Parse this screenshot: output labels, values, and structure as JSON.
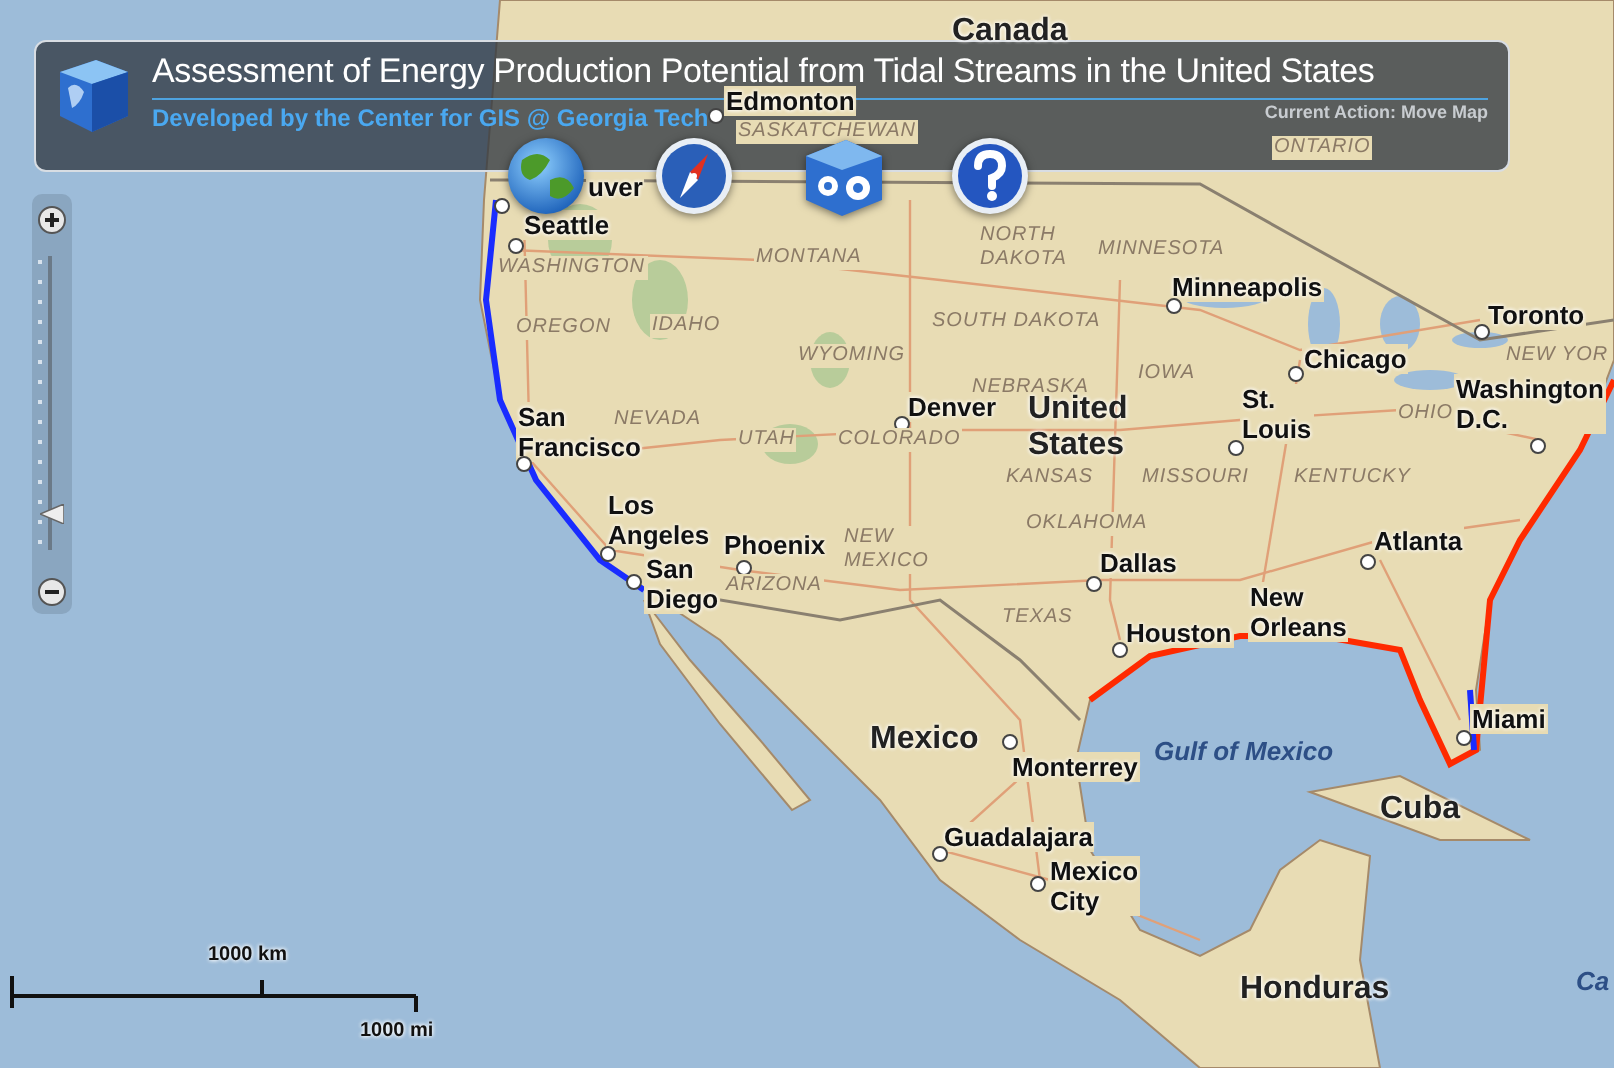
{
  "header": {
    "title": "Assessment of Energy Production Potential from Tidal Streams in the United States",
    "subtitle": "Developed by the Center for GIS @ Georgia Tech",
    "current_action": "Current Action: Move Map"
  },
  "toolbar": [
    {
      "kind": "globe"
    },
    {
      "kind": "compass"
    },
    {
      "kind": "settings"
    },
    {
      "kind": "help"
    }
  ],
  "zoom_control": {
    "level": 0.12
  },
  "scale_bar": {
    "km_label": "1000 km",
    "mi_label": "1000 mi"
  },
  "map": {
    "labels": [
      {
        "text": "Canada",
        "kind": "country"
      },
      {
        "text": "Edmonton",
        "kind": "city"
      },
      {
        "text": "SASKATCHEWAN",
        "kind": "state"
      },
      {
        "text": "ONTARIO",
        "kind": "state"
      },
      {
        "text": "uver",
        "kind": "city"
      },
      {
        "text": "Seattle",
        "kind": "city"
      },
      {
        "text": "WASHINGTON",
        "kind": "state"
      },
      {
        "text": "MONTANA",
        "kind": "state"
      },
      {
        "text": "NORTH DAKOTA",
        "kind": "state"
      },
      {
        "text": "MINNESOTA",
        "kind": "state"
      },
      {
        "text": "Minneapolis",
        "kind": "city"
      },
      {
        "text": "OREGON",
        "kind": "state"
      },
      {
        "text": "IDAHO",
        "kind": "state"
      },
      {
        "text": "SOUTH DAKOTA",
        "kind": "state"
      },
      {
        "text": "Toronto",
        "kind": "city"
      },
      {
        "text": "WYOMING",
        "kind": "state"
      },
      {
        "text": "Chicago",
        "kind": "city"
      },
      {
        "text": "NEW YOR",
        "kind": "state"
      },
      {
        "text": "IOWA",
        "kind": "state"
      },
      {
        "text": "NEBRASKA",
        "kind": "state"
      },
      {
        "text": "Denver",
        "kind": "city"
      },
      {
        "text": "United States",
        "kind": "country"
      },
      {
        "text": "St. Louis",
        "kind": "city"
      },
      {
        "text": "OHIO",
        "kind": "state"
      },
      {
        "text": "Washington D.C.",
        "kind": "city"
      },
      {
        "text": "San Francisco",
        "kind": "city"
      },
      {
        "text": "NEVADA",
        "kind": "state"
      },
      {
        "text": "UTAH",
        "kind": "state"
      },
      {
        "text": "COLORADO",
        "kind": "state"
      },
      {
        "text": "KANSAS",
        "kind": "state"
      },
      {
        "text": "MISSOURI",
        "kind": "state"
      },
      {
        "text": "KENTUCKY",
        "kind": "state"
      },
      {
        "text": "Los Angeles",
        "kind": "city"
      },
      {
        "text": "Phoenix",
        "kind": "city"
      },
      {
        "text": "NEW MEXICO",
        "kind": "state"
      },
      {
        "text": "OKLAHOMA",
        "kind": "state"
      },
      {
        "text": "Atlanta",
        "kind": "city"
      },
      {
        "text": "San Diego",
        "kind": "city"
      },
      {
        "text": "ARIZONA",
        "kind": "state"
      },
      {
        "text": "Dallas",
        "kind": "city"
      },
      {
        "text": "TEXAS",
        "kind": "state"
      },
      {
        "text": "Houston",
        "kind": "city"
      },
      {
        "text": "New Orleans",
        "kind": "city"
      },
      {
        "text": "Mexico",
        "kind": "country"
      },
      {
        "text": "Gulf of Mexico",
        "kind": "water"
      },
      {
        "text": "Monterrey",
        "kind": "city"
      },
      {
        "text": "Miami",
        "kind": "city"
      },
      {
        "text": "Cuba",
        "kind": "country"
      },
      {
        "text": "Guadalajara",
        "kind": "city"
      },
      {
        "text": "Mexico City",
        "kind": "city"
      },
      {
        "text": "Honduras",
        "kind": "country"
      },
      {
        "text": "Ca",
        "kind": "water"
      }
    ]
  }
}
